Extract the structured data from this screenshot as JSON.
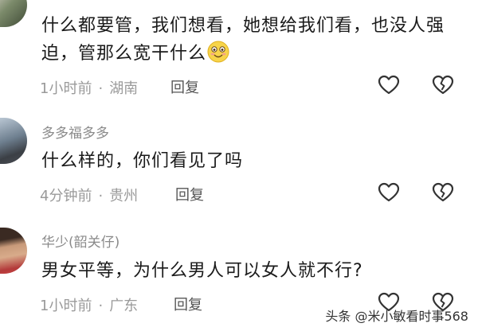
{
  "comments": [
    {
      "username": "",
      "text": "什么都要管，我们想看，她想给我们看，也没人强迫，管那么宽干什么",
      "emoji": "smiling-face-emoji",
      "time": "1小时前",
      "location": "湖南",
      "reply_label": "回复"
    },
    {
      "username": "多多福多多",
      "text": "什么样的，你们看见了吗",
      "time": "4分钟前",
      "location": "贵州",
      "reply_label": "回复"
    },
    {
      "username": "华少(韶关仔)",
      "text": "男女平等，为什么男人可以女人就不行?",
      "time": "1小时前",
      "location": "广东",
      "reply_label": "回复"
    }
  ],
  "meta_separator": "·",
  "watermark": "头条 @米小敏看时事568",
  "colors": {
    "text": "#1a1a1a",
    "meta": "#9a9a9a",
    "icon_stroke": "#333333"
  }
}
